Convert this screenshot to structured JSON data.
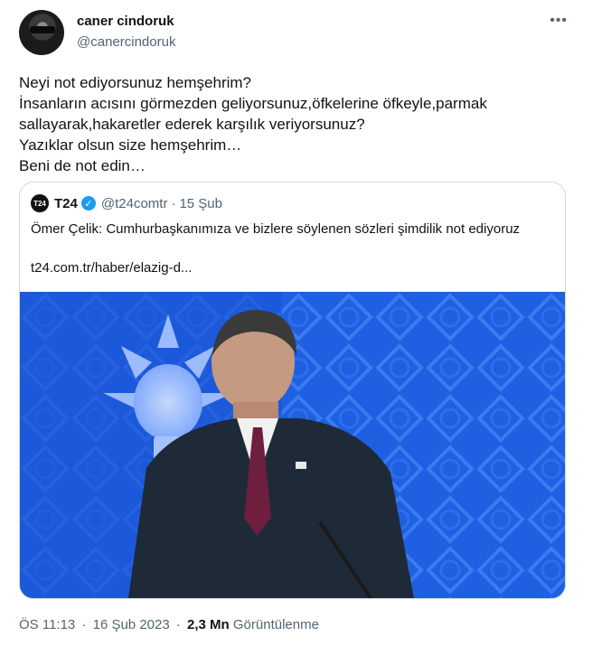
{
  "author": {
    "display_name": "caner cindoruk",
    "handle": "@canercindoruk"
  },
  "more_icon": "more-horizontal-icon",
  "tweet_text": "Neyi not ediyorsunuz hemşehrim?\nİnsanların acısını görmezden geliyorsunuz,öfkelerine öfkeyle,parmak sallayarak,hakaretler ederek karşılık veriyorsunuz?\nYazıklar olsun size hemşehrim…\nBeni de not edin…",
  "quoted": {
    "logo_text": "T24",
    "name": "T24",
    "verified_icon": "verified-badge-icon",
    "handle": "@t24comtr",
    "separator": "·",
    "date": "15 Şub",
    "text": "Ömer Çelik: Cumhurbaşkanımıza ve bizlere söylenen sözleri şimdilik not ediyoruz",
    "link": "t24.com.tr/haber/elazig-d..."
  },
  "footer": {
    "time": "ÖS 11:13",
    "separator": "·",
    "date": "16 Şub 2023",
    "separator2": "·",
    "views_count": "2,3 Mn",
    "views_label": "Görüntülenme"
  },
  "colors": {
    "text": "#0f1419",
    "secondary": "#536471",
    "border": "#cfd9de",
    "verified": "#1d9bf0",
    "image_background": "#1a56d6"
  }
}
